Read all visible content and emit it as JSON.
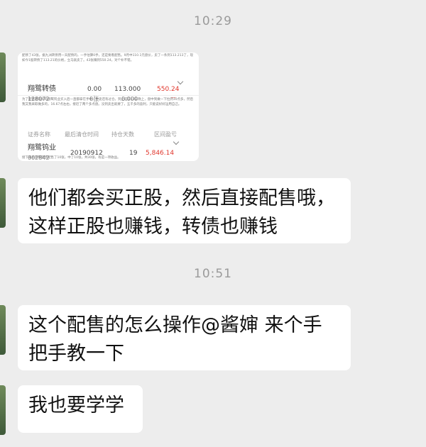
{
  "timestamps": [
    "10:29",
    "10:51"
  ],
  "screenshot": {
    "note_top": "配债了43张，据九洲转债用一天配债的，一手估算0手，还是要看配售。9月中110.1元盘价，卖了一条到113.213了，现如今1股转债了113.21的价格，立马就卖了。43张赚到550.24，对个补不错。",
    "bond": {
      "name": "翔鹭转债",
      "code": "128072",
      "col2_top": "0.00",
      "col2_bottom": "0张",
      "col3_top": "113.000",
      "col3_bottom": "0.000",
      "profit": "550.24",
      "profit_sub": "--"
    },
    "note_mid": "为了配售而购买的翔鹭钨业买入后一直都拿在手中，中途还有过仓。到止前日12日晚上，盘中到做一下拉到10点多，然后我又我采取做多的，16.67点左右，接近了两个多点盘。没到卖出就要了，五千多的盈利，只能说好好运用自己。",
    "headers": [
      "证券名称",
      "最后清仓时间",
      "持仓天数",
      "区间盈亏"
    ],
    "stock": {
      "name": "翔鹭钨业",
      "code": "002842",
      "date": "20190912",
      "days": "19",
      "profit": "5,846.14"
    },
    "note_bottom": "接下来有翔鹭转债配售了10张，中了10张，共30张，有是一项收益。"
  },
  "messages": [
    "他们都会买正股，然后直接配售哦，这样正股也赚钱，转债也赚钱",
    "这个配售的怎么操作@酱婶  来个手把手教一下",
    "我也要学学"
  ],
  "colors": {
    "background": "#ededed",
    "bubble": "#ffffff",
    "profit_red": "#e0352b"
  }
}
